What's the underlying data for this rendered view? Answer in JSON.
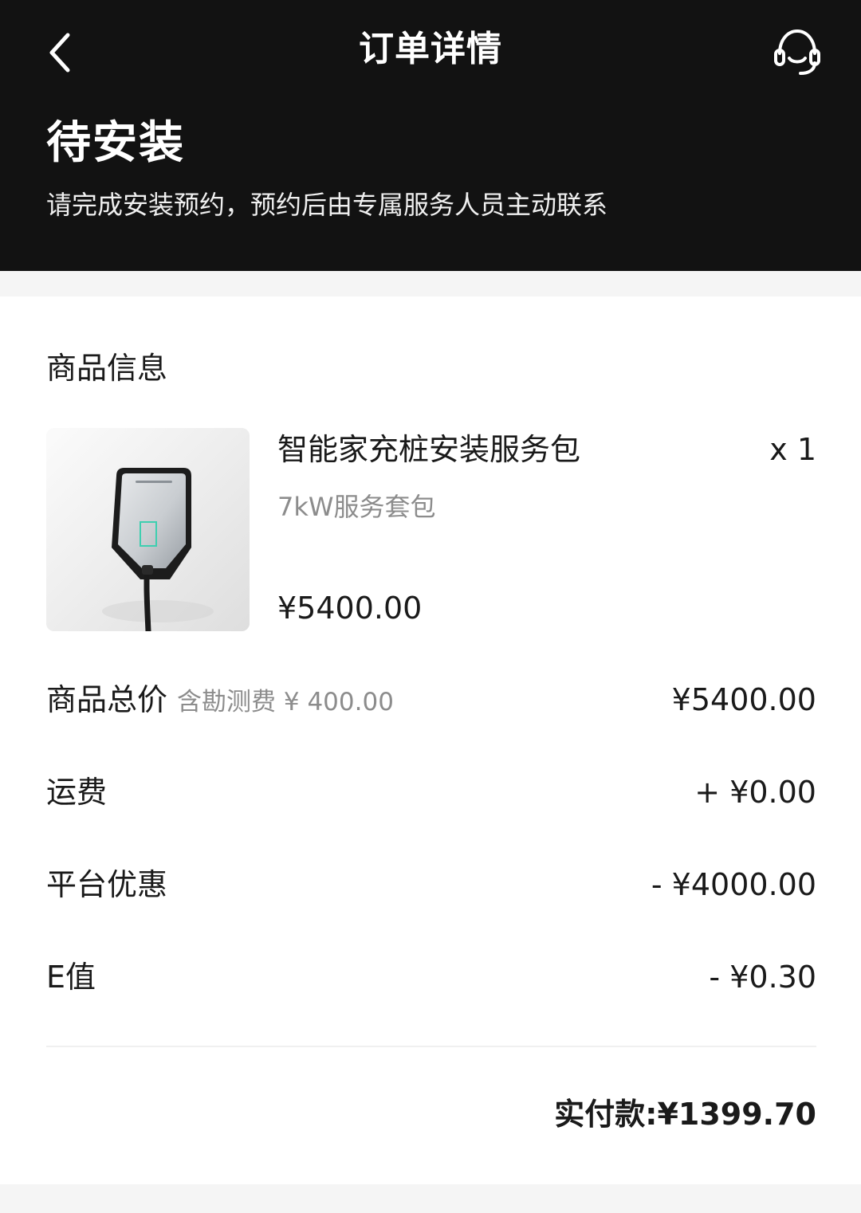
{
  "nav": {
    "title": "订单详情",
    "back_icon": "chevron-left-icon",
    "service_icon": "headset-icon"
  },
  "status": {
    "title": "待安装",
    "description": "请完成安装预约，预约后由专属服务人员主动联系"
  },
  "product_section": {
    "title": "商品信息",
    "product": {
      "name": "智能家充桩安装服务包",
      "quantity": "x 1",
      "spec": "7kW服务套包",
      "price": "¥5400.00",
      "image_icon": "ev-charger-image"
    }
  },
  "fees": {
    "subtotal_label": "商品总价",
    "subtotal_note": "含勘测费 ¥ 400.00",
    "subtotal_value": "¥5400.00",
    "shipping_label": "运费",
    "shipping_value": "+ ¥0.00",
    "discount_label": "平台优惠",
    "discount_value": "- ¥4000.00",
    "evalue_label": "E值",
    "evalue_value": "- ¥0.30"
  },
  "total": {
    "label": "实付款:",
    "value": "¥1399.70"
  },
  "colors": {
    "header_bg": "#121212",
    "page_bg": "#f5f5f5",
    "card_bg": "#ffffff",
    "secondary_text": "#8c8c8c",
    "charger_accent": "#3ecfb0"
  }
}
